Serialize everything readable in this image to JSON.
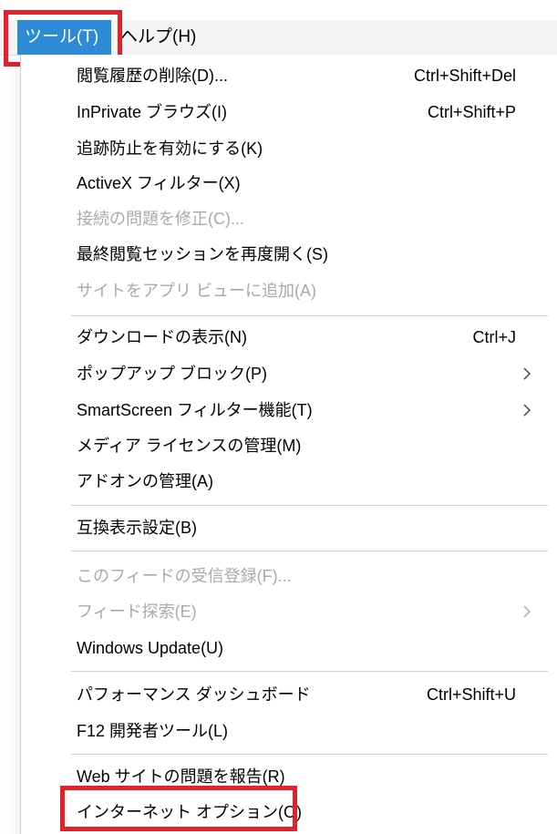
{
  "menubar": {
    "tools_label": "ツール(T)",
    "help_label": "ヘルプ(H)"
  },
  "menu": {
    "items": [
      {
        "label": "閲覧履歴の削除(D)...",
        "shortcut": "Ctrl+Shift+Del",
        "enabled": true
      },
      {
        "label": "InPrivate ブラウズ(I)",
        "shortcut": "Ctrl+Shift+P",
        "enabled": true
      },
      {
        "label": "追跡防止を有効にする(K)",
        "shortcut": "",
        "enabled": true
      },
      {
        "label": "ActiveX フィルター(X)",
        "shortcut": "",
        "enabled": true
      },
      {
        "label": "接続の問題を修正(C)...",
        "shortcut": "",
        "enabled": false
      },
      {
        "label": "最終閲覧セッションを再度開く(S)",
        "shortcut": "",
        "enabled": true
      },
      {
        "label": "サイトをアプリ ビューに追加(A)",
        "shortcut": "",
        "enabled": false
      },
      {
        "label": "ダウンロードの表示(N)",
        "shortcut": "Ctrl+J",
        "enabled": true
      },
      {
        "label": "ポップアップ ブロック(P)",
        "shortcut": "",
        "enabled": true,
        "submenu": true
      },
      {
        "label": "SmartScreen フィルター機能(T)",
        "shortcut": "",
        "enabled": true,
        "submenu": true
      },
      {
        "label": "メディア ライセンスの管理(M)",
        "shortcut": "",
        "enabled": true
      },
      {
        "label": "アドオンの管理(A)",
        "shortcut": "",
        "enabled": true
      },
      {
        "label": "互換表示設定(B)",
        "shortcut": "",
        "enabled": true
      },
      {
        "label": "このフィードの受信登録(F)...",
        "shortcut": "",
        "enabled": false
      },
      {
        "label": "フィード探索(E)",
        "shortcut": "",
        "enabled": false,
        "submenu": true
      },
      {
        "label": "Windows Update(U)",
        "shortcut": "",
        "enabled": true
      },
      {
        "label": "パフォーマンス ダッシュボード",
        "shortcut": "Ctrl+Shift+U",
        "enabled": true
      },
      {
        "label": "F12 開発者ツール(L)",
        "shortcut": "",
        "enabled": true
      },
      {
        "label": "Web サイトの問題を報告(R)",
        "shortcut": "",
        "enabled": true
      },
      {
        "label": "インターネット オプション(O)",
        "shortcut": "",
        "enabled": true,
        "highlighted": true
      }
    ]
  },
  "colors": {
    "active_menu_bg": "#2d8ad4",
    "highlight_border": "#e3212a",
    "disabled_text": "#a9a9a9"
  },
  "icons": {
    "submenu": "chevron-right-icon"
  }
}
